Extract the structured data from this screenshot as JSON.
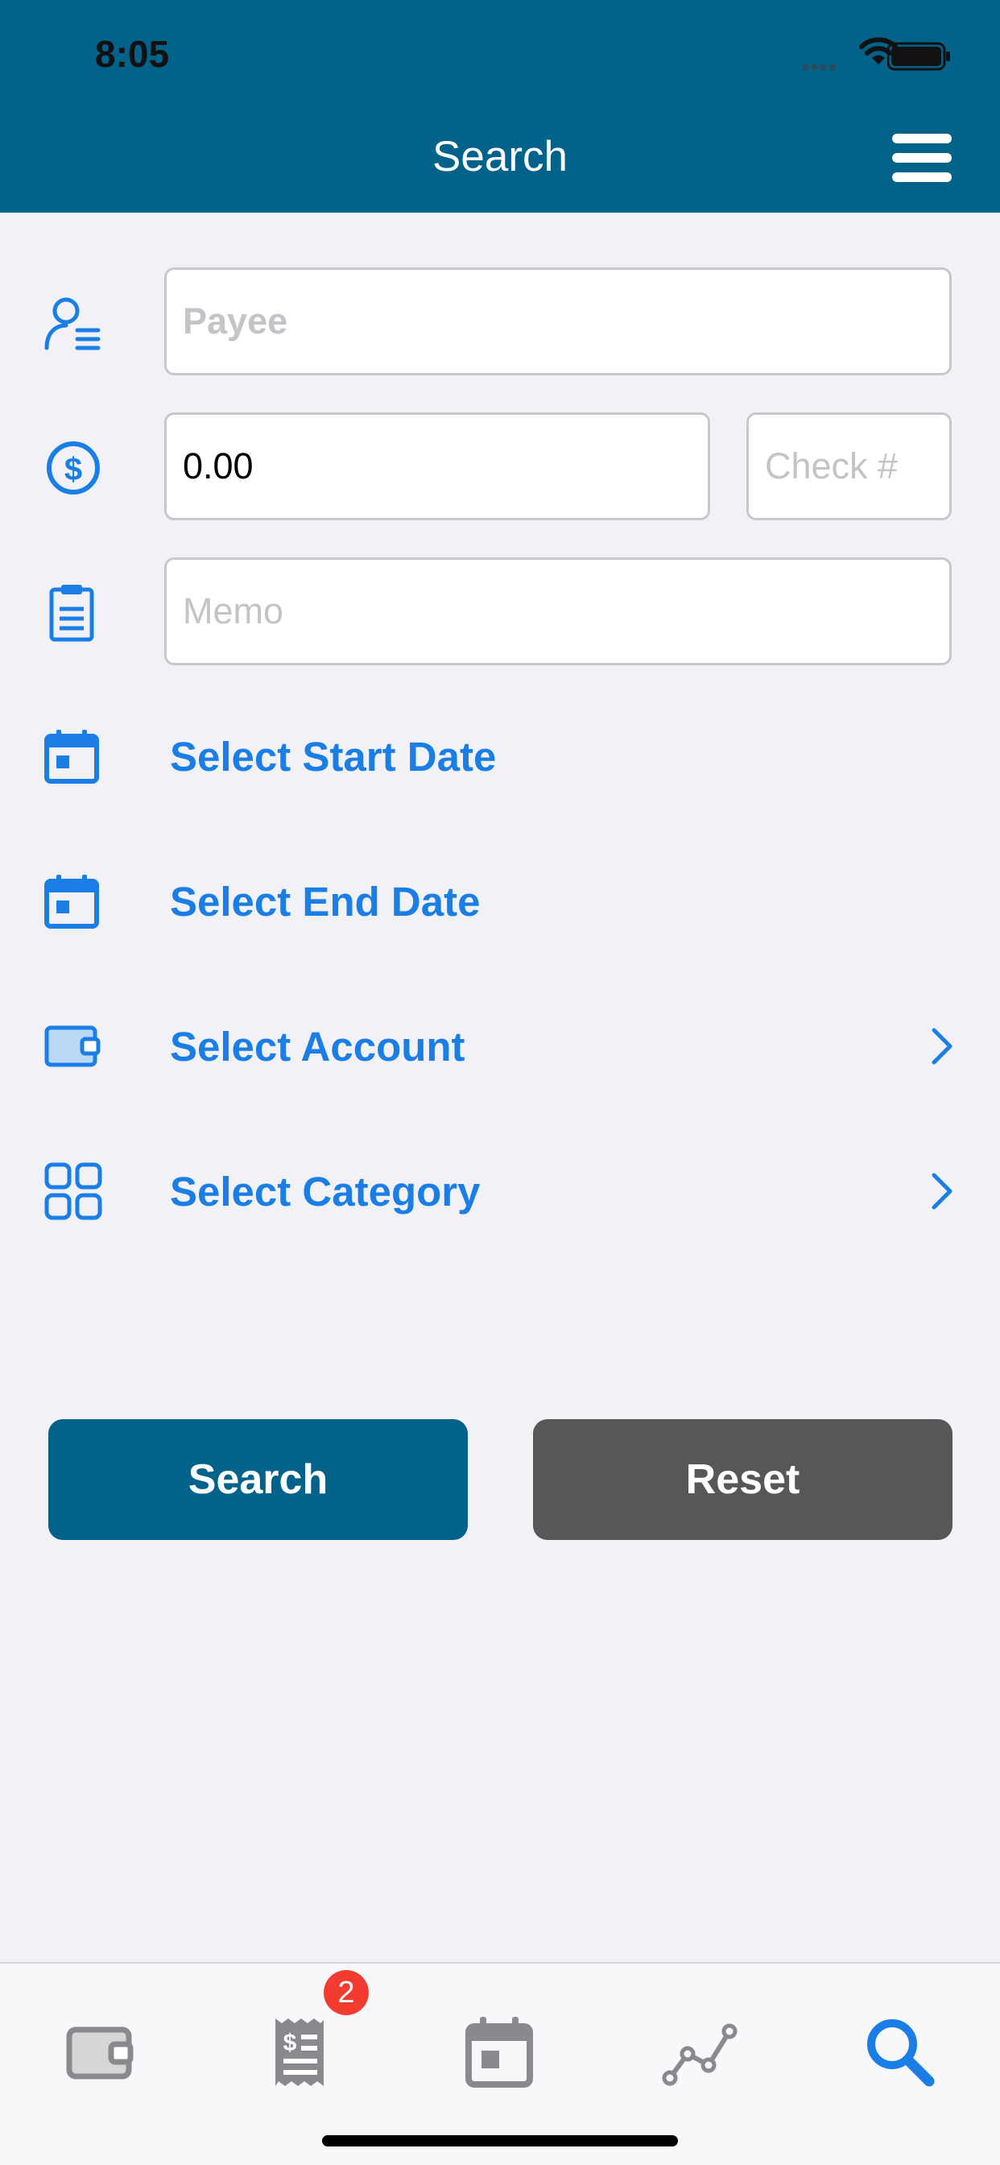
{
  "status_bar": {
    "time": "8:05"
  },
  "nav": {
    "title": "Search"
  },
  "form": {
    "payee_placeholder": "Payee",
    "amount_value": "0.00",
    "check_placeholder": "Check #",
    "memo_placeholder": "Memo",
    "start_date_label": "Select Start Date",
    "end_date_label": "Select End Date",
    "account_label": "Select Account",
    "category_label": "Select Category"
  },
  "buttons": {
    "search": "Search",
    "reset": "Reset"
  },
  "tabbar": {
    "tabs": [
      {
        "icon": "wallet-icon",
        "active": false
      },
      {
        "icon": "receipt-icon",
        "active": false,
        "badge": "2"
      },
      {
        "icon": "calendar-icon",
        "active": false
      },
      {
        "icon": "chart-line-icon",
        "active": false
      },
      {
        "icon": "search-icon",
        "active": true
      }
    ]
  },
  "colors": {
    "header": "#03628a",
    "accent": "#1a7ee6",
    "reset": "#575757",
    "badge": "#f33b30"
  }
}
